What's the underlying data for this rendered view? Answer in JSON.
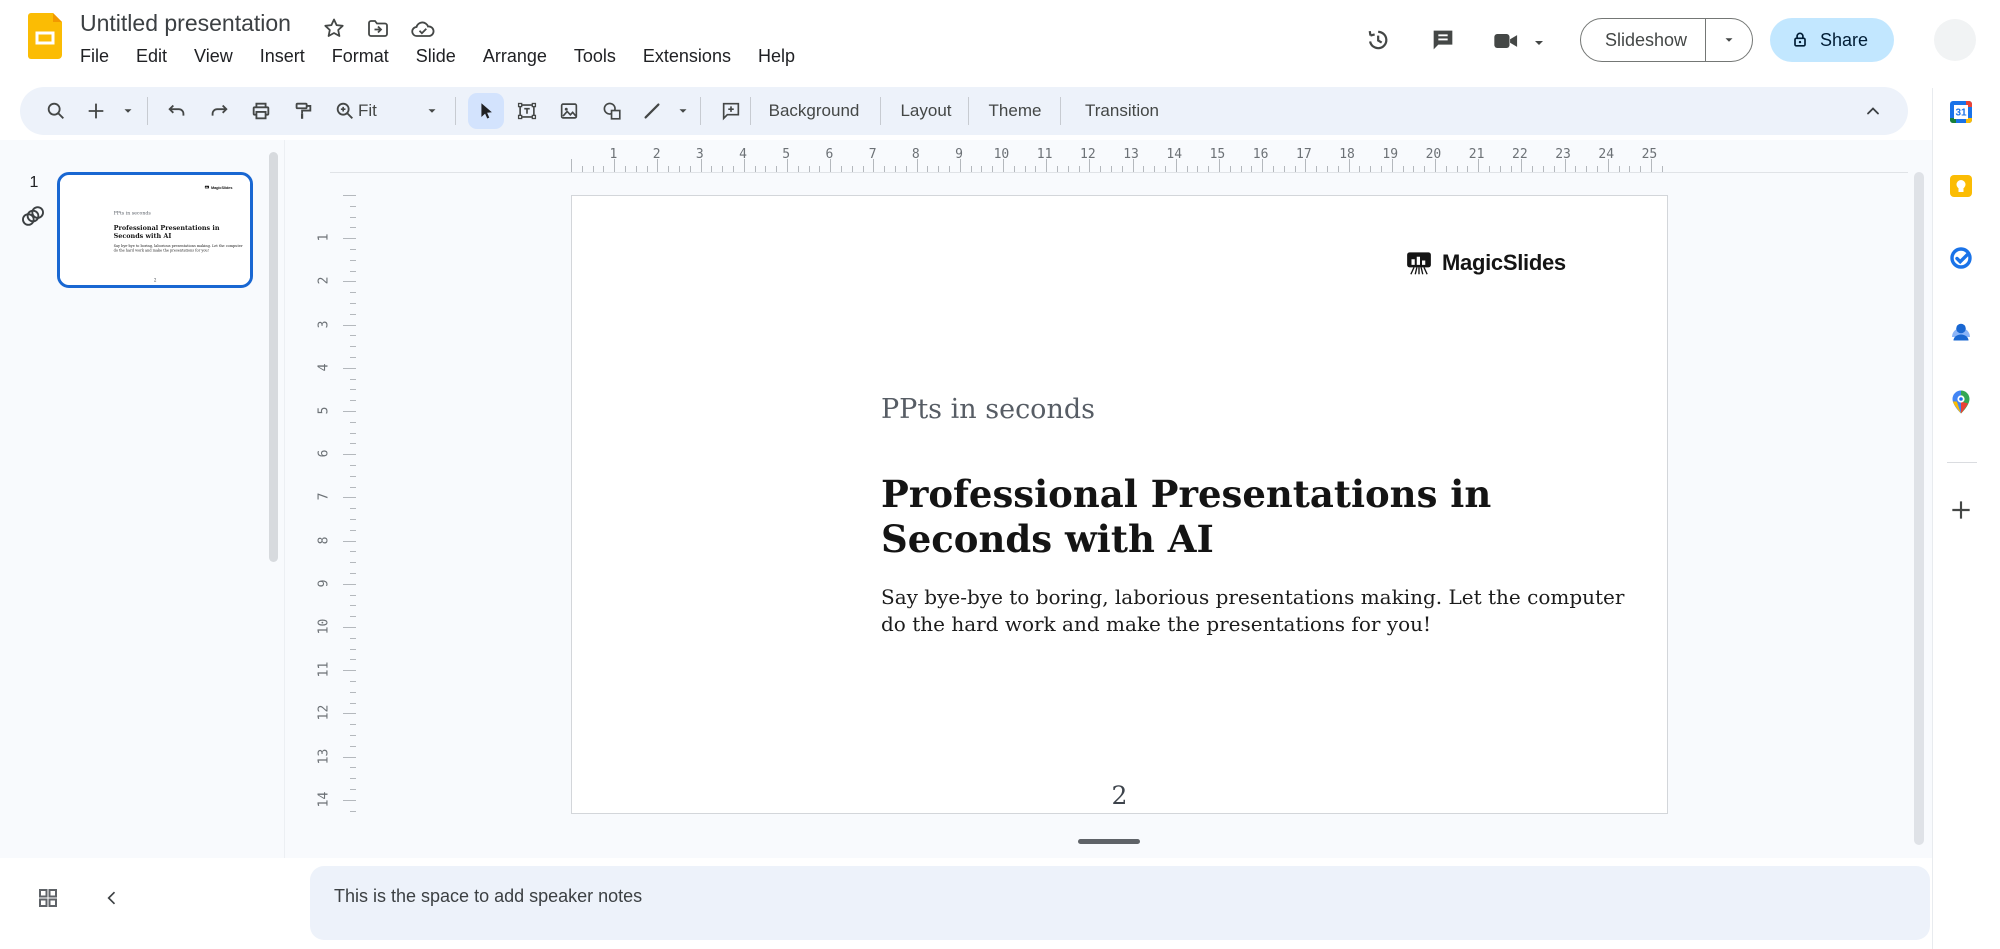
{
  "header": {
    "title": "Untitled presentation",
    "menu": [
      "File",
      "Edit",
      "View",
      "Insert",
      "Format",
      "Slide",
      "Arrange",
      "Tools",
      "Extensions",
      "Help"
    ],
    "slideshow": "Slideshow",
    "share": "Share"
  },
  "toolbar": {
    "zoom": "Fit",
    "background": "Background",
    "layout": "Layout",
    "theme": "Theme",
    "transition": "Transition"
  },
  "filmstrip": {
    "slide_number": "1"
  },
  "rulers": {
    "horizontal": [
      "1",
      "2",
      "3",
      "4",
      "5",
      "6",
      "7",
      "8",
      "9",
      "10",
      "11",
      "12",
      "13",
      "14",
      "15",
      "16",
      "17",
      "18",
      "19",
      "20",
      "21",
      "22",
      "23",
      "24",
      "25"
    ],
    "vertical": [
      "1",
      "2",
      "3",
      "4",
      "5",
      "6",
      "7",
      "8",
      "9",
      "10",
      "11",
      "12",
      "13",
      "14"
    ]
  },
  "slide": {
    "brand": "MagicSlides",
    "kicker": "PPts in seconds",
    "title_lines": [
      "Professional Presentations in",
      "Seconds with AI"
    ],
    "body_lines": [
      "Say bye-bye to boring, laborious presentations making. Let the computer",
      "do the hard work and make the presentations for you!"
    ],
    "page_number": "2"
  },
  "notes": {
    "placeholder": "This is the space to add speaker notes"
  },
  "icons": {
    "calendar_day": "31"
  },
  "colors": {
    "accent_blue": "#0b57d0",
    "selected_tool_bg": "#d3e3fd",
    "share_bg": "#c2e7ff",
    "toolbar_bg": "#edf2fa",
    "canvas_bg": "#f8fafd",
    "selected_thumb_border": "#1967d2"
  }
}
